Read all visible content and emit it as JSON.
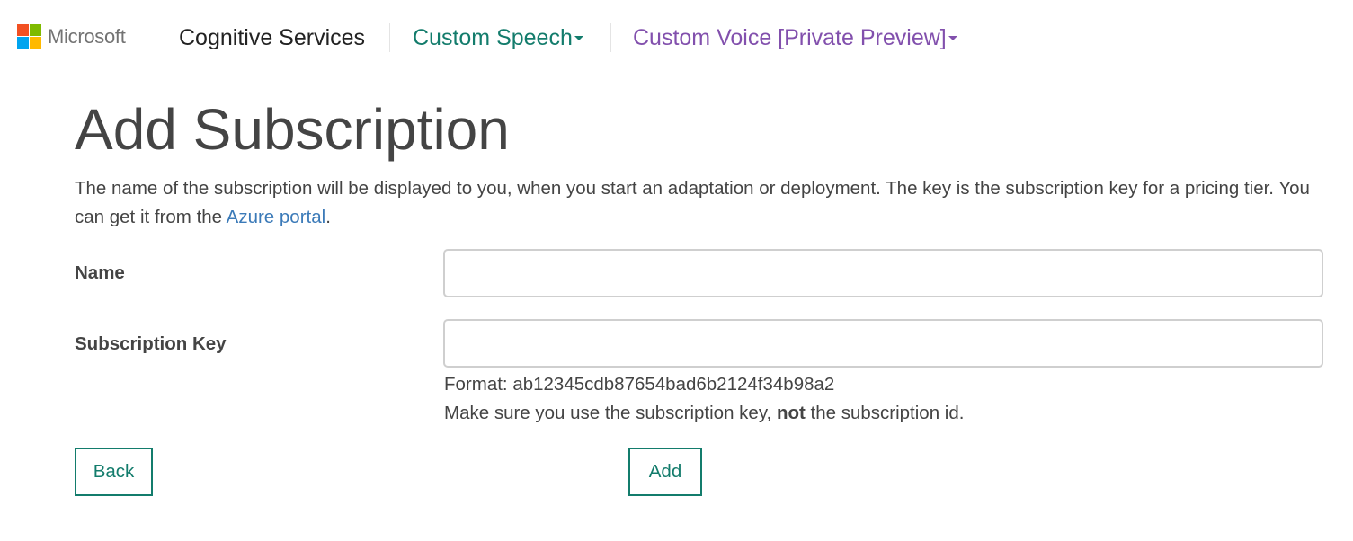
{
  "nav": {
    "brand": "Microsoft",
    "brand_colors": [
      "#f25022",
      "#7fba00",
      "#00a4ef",
      "#ffb900"
    ],
    "items": [
      {
        "label": "Cognitive Services",
        "color": "#222222",
        "has_dropdown": false
      },
      {
        "label": "Custom Speech",
        "color": "#137c6c",
        "has_dropdown": true
      },
      {
        "label": "Custom Voice [Private Preview]",
        "color": "#8250ad",
        "has_dropdown": true
      }
    ]
  },
  "page": {
    "title": "Add Subscription",
    "intro_text": "The name of the subscription will be displayed to you, when you start an adaptation or deployment. The key is the subscription key for a pricing tier. You can get it from the ",
    "intro_link": "Azure portal",
    "intro_end": "."
  },
  "form": {
    "name_label": "Name",
    "name_value": "",
    "key_label": "Subscription Key",
    "key_value": "",
    "format_hint": "Format: ab12345cdb87654bad6b2124f34b98a2",
    "note_before": "Make sure you use the subscription key, ",
    "note_bold": "not",
    "note_after": " the subscription id."
  },
  "buttons": {
    "back": "Back",
    "add": "Add"
  },
  "colors": {
    "accent": "#137c6c",
    "voice": "#8250ad",
    "link": "#3b7ab8"
  }
}
